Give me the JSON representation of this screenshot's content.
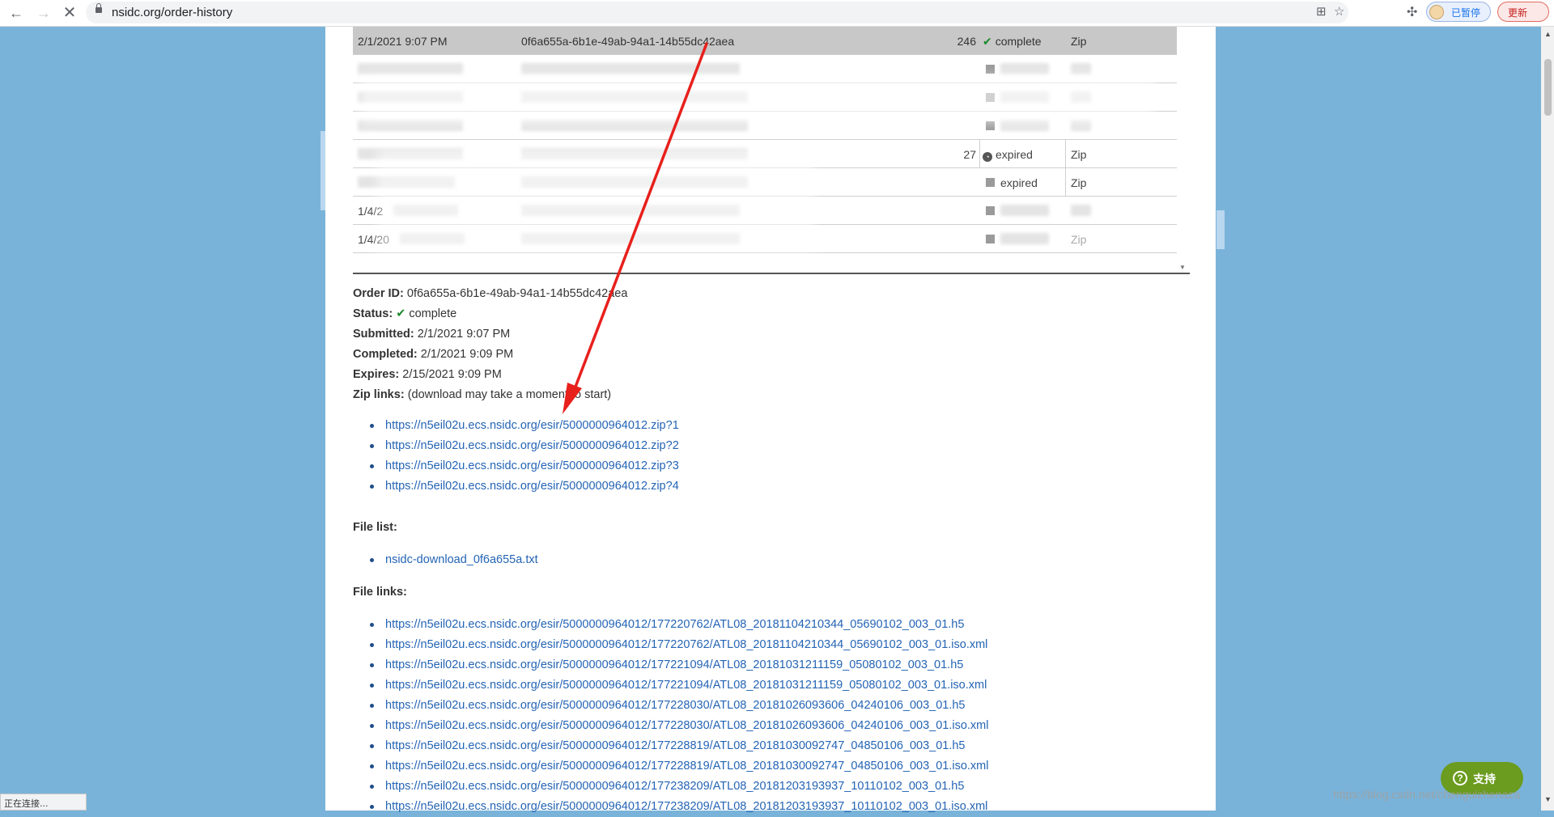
{
  "browser": {
    "url": "nsidc.org/order-history",
    "paused_label": "已暂停",
    "update_label": "更新"
  },
  "table": {
    "selected_row": {
      "date": "2/1/2021 9:07 PM",
      "order_id": "0f6a655a-6b1e-49ab-94a1-14b55dc42aea",
      "count": "246",
      "status": "complete",
      "type": "Zip"
    },
    "rows": [
      {
        "date": "",
        "order_id": "",
        "count": "",
        "status": "",
        "type": ""
      },
      {
        "date": "",
        "order_id": "",
        "count": "",
        "status": "",
        "type": ""
      },
      {
        "date": "",
        "order_id": "",
        "count": "",
        "status": "",
        "type": ""
      },
      {
        "date": "",
        "order_id": "",
        "count": "27",
        "status": "expired",
        "type": "Zip"
      },
      {
        "date": "",
        "order_id": "",
        "count": "",
        "status": "expired",
        "type": "Zip"
      },
      {
        "date": "1/4/2",
        "order_id": "",
        "count": "",
        "status": "",
        "type": ""
      },
      {
        "date": "1/4/20",
        "order_id": "",
        "count": "",
        "status": "",
        "type": "Zip"
      }
    ]
  },
  "details": {
    "order_id_label": "Order ID:",
    "order_id": "0f6a655a-6b1e-49ab-94a1-14b55dc42aea",
    "status_label": "Status:",
    "status": "complete",
    "submitted_label": "Submitted:",
    "submitted": "2/1/2021 9:07 PM",
    "completed_label": "Completed:",
    "completed": "2/1/2021 9:09 PM",
    "expires_label": "Expires:",
    "expires": "2/15/2021 9:09 PM",
    "zip_links_label": "Zip links:",
    "zip_links_note": "(download may take a moment to start)"
  },
  "zip_links": [
    "https://n5eil02u.ecs.nsidc.org/esir/5000000964012.zip?1",
    "https://n5eil02u.ecs.nsidc.org/esir/5000000964012.zip?2",
    "https://n5eil02u.ecs.nsidc.org/esir/5000000964012.zip?3",
    "https://n5eil02u.ecs.nsidc.org/esir/5000000964012.zip?4"
  ],
  "file_list_label": "File list:",
  "file_list": [
    "nsidc-download_0f6a655a.txt"
  ],
  "file_links_label": "File links:",
  "file_links": [
    "https://n5eil02u.ecs.nsidc.org/esir/5000000964012/177220762/ATL08_20181104210344_05690102_003_01.h5",
    "https://n5eil02u.ecs.nsidc.org/esir/5000000964012/177220762/ATL08_20181104210344_05690102_003_01.iso.xml",
    "https://n5eil02u.ecs.nsidc.org/esir/5000000964012/177221094/ATL08_20181031211159_05080102_003_01.h5",
    "https://n5eil02u.ecs.nsidc.org/esir/5000000964012/177221094/ATL08_20181031211159_05080102_003_01.iso.xml",
    "https://n5eil02u.ecs.nsidc.org/esir/5000000964012/177228030/ATL08_20181026093606_04240106_003_01.h5",
    "https://n5eil02u.ecs.nsidc.org/esir/5000000964012/177228030/ATL08_20181026093606_04240106_003_01.iso.xml",
    "https://n5eil02u.ecs.nsidc.org/esir/5000000964012/177228819/ATL08_20181030092747_04850106_003_01.h5",
    "https://n5eil02u.ecs.nsidc.org/esir/5000000964012/177228819/ATL08_20181030092747_04850106_003_01.iso.xml",
    "https://n5eil02u.ecs.nsidc.org/esir/5000000964012/177238209/ATL08_20181203193937_10110102_003_01.h5",
    "https://n5eil02u.ecs.nsidc.org/esir/5000000964012/177238209/ATL08_20181203193937_10110102_003_01.iso.xml"
  ],
  "status_bar": "正在连接...",
  "support_label": "支持",
  "watermark": "https://blog.csdn.net/chenguizhenaza",
  "colors": {
    "background": "#7ab3d9",
    "link": "#2464b4",
    "check": "#1b8a2e",
    "arrow": "#e8201c",
    "support": "#6b9b1f"
  }
}
